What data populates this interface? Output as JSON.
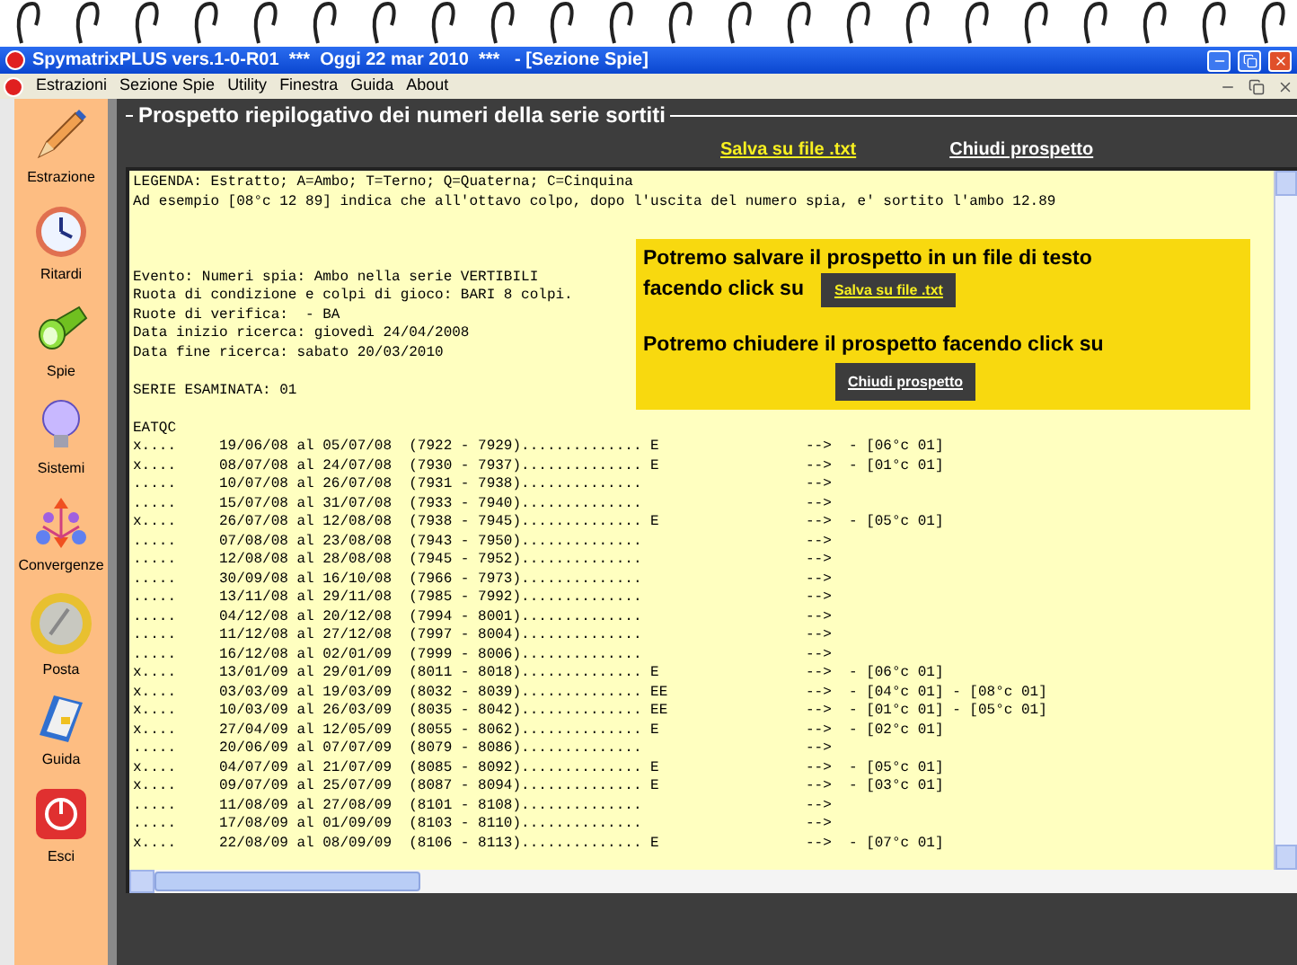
{
  "window": {
    "title": "SpymatrixPLUS vers.1-0-R01  ***  Oggi 22 mar 2010  ***   - [Sezione Spie]"
  },
  "menu": [
    "Estrazioni",
    "Sezione Spie",
    "Utility",
    "Finestra",
    "Guida",
    "About"
  ],
  "sidebar": {
    "items": [
      {
        "kind": "pencil",
        "label": "Estrazione"
      },
      {
        "kind": "clock",
        "label": "Ritardi"
      },
      {
        "kind": "flashlight",
        "label": "Spie"
      },
      {
        "kind": "bulb",
        "label": "Sistemi"
      },
      {
        "kind": "converge",
        "label": "Convergenze"
      },
      {
        "kind": "coin",
        "label": "Posta"
      },
      {
        "kind": "book",
        "label": "Guida"
      },
      {
        "kind": "power",
        "label": "Esci"
      }
    ]
  },
  "panel": {
    "title": "Prospetto riepilogativo dei numeri della serie sortiti",
    "links": [
      {
        "kind": "save",
        "label": "Salva su file .txt"
      },
      {
        "kind": "close",
        "label": "Chiudi prospetto"
      }
    ]
  },
  "report": {
    "legend": [
      "LEGENDA: Estratto; A=Ambo; T=Terno; Q=Quaterna; C=Cinquina",
      "Ad esempio [08°c 12 89] indica che all'ottavo colpo, dopo l'uscita del numero spia, e' sortito l'ambo 12.89"
    ],
    "event": [
      "Evento: Numeri spia: Ambo nella serie VERTIBILI",
      "Ruota di condizione e colpi di gioco: BARI 8 colpi.",
      "Ruote di verifica:  - BA",
      "Data inizio ricerca: giovedì 24/04/2008",
      "Data fine ricerca: sabato 20/03/2010"
    ],
    "series": "SERIE ESAMINATA: 01",
    "header": "EATQC",
    "rows": [
      "x....     19/06/08 al 05/07/08  (7922 - 7929).............. E                 -->  - [06°c 01]",
      "x....     08/07/08 al 24/07/08  (7930 - 7937).............. E                 -->  - [01°c 01]",
      ".....     10/07/08 al 26/07/08  (7931 - 7938)..............                   -->",
      ".....     15/07/08 al 31/07/08  (7933 - 7940)..............                   -->",
      "x....     26/07/08 al 12/08/08  (7938 - 7945).............. E                 -->  - [05°c 01]",
      ".....     07/08/08 al 23/08/08  (7943 - 7950)..............                   -->",
      ".....     12/08/08 al 28/08/08  (7945 - 7952)..............                   -->",
      ".....     30/09/08 al 16/10/08  (7966 - 7973)..............                   -->",
      ".....     13/11/08 al 29/11/08  (7985 - 7992)..............                   -->",
      ".....     04/12/08 al 20/12/08  (7994 - 8001)..............                   -->",
      ".....     11/12/08 al 27/12/08  (7997 - 8004)..............                   -->",
      ".....     16/12/08 al 02/01/09  (7999 - 8006)..............                   -->",
      "x....     13/01/09 al 29/01/09  (8011 - 8018).............. E                 -->  - [06°c 01]",
      "x....     03/03/09 al 19/03/09  (8032 - 8039).............. EE                -->  - [04°c 01] - [08°c 01]",
      "x....     10/03/09 al 26/03/09  (8035 - 8042).............. EE                -->  - [01°c 01] - [05°c 01]",
      "x....     27/04/09 al 12/05/09  (8055 - 8062).............. E                 -->  - [02°c 01]",
      ".....     20/06/09 al 07/07/09  (8079 - 8086)..............                   -->",
      "x....     04/07/09 al 21/07/09  (8085 - 8092).............. E                 -->  - [05°c 01]",
      "x....     09/07/09 al 25/07/09  (8087 - 8094).............. E                 -->  - [03°c 01]",
      ".....     11/08/09 al 27/08/09  (8101 - 8108)..............                   -->",
      ".....     17/08/09 al 01/09/09  (8103 - 8110)..............                   -->",
      "x....     22/08/09 al 08/09/09  (8106 - 8113).............. E                 -->  - [07°c 01]"
    ]
  },
  "callout": {
    "save_line_1": "Potremo salvare il prospetto in un file di testo",
    "save_line_2": "facendo click su",
    "save_button": "Salva su file .txt",
    "close_line": "Potremo chiudere il prospetto facendo click su",
    "close_button": "Chiudi prospetto"
  }
}
